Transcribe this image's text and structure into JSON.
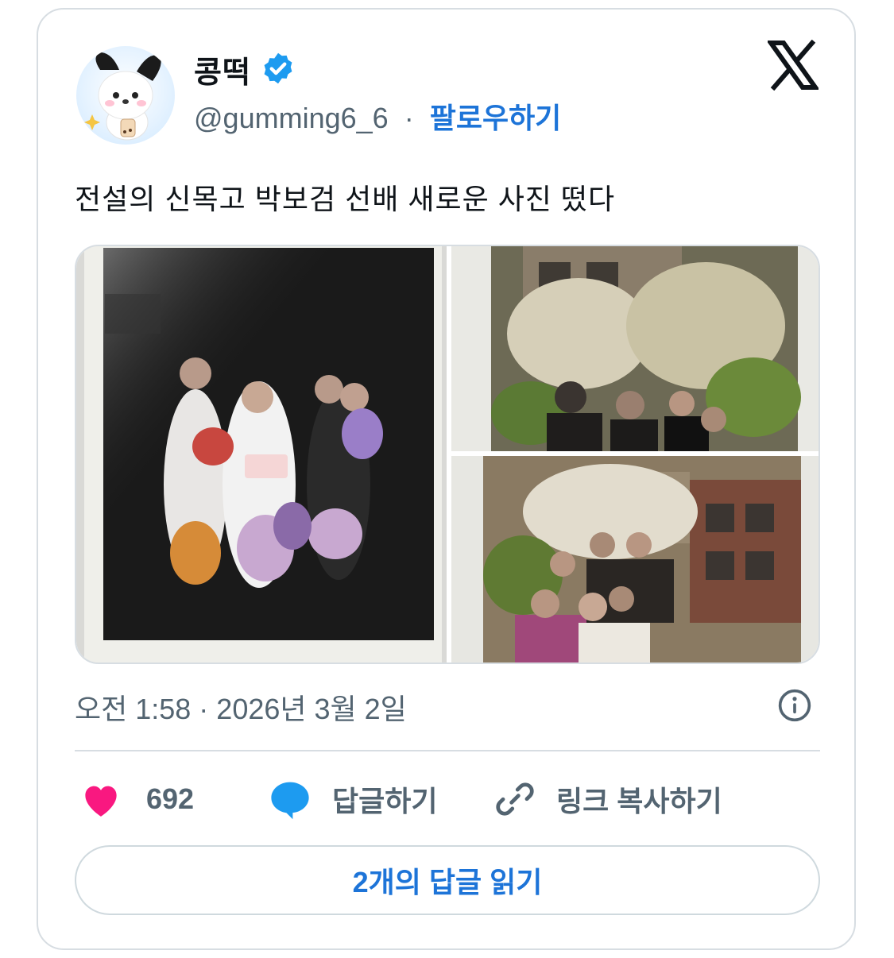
{
  "author": {
    "display_name": "콩떡",
    "handle": "@gumming6_6",
    "separator": "·",
    "follow_label": "팔로우하기",
    "verified_color": "#1d9bf0",
    "avatar_icon": "puppy-character-avatar"
  },
  "brand": {
    "logo_icon": "x-logo-icon"
  },
  "tweet": {
    "text": "전설의 신목고 박보검 선배 새로운 사진 떴다",
    "timestamp": "오전 1:58 · 2026년 3월 2일",
    "media": [
      {
        "icon": "polaroid-photo-birthday-group"
      },
      {
        "icon": "polaroid-photo-spring-trees"
      },
      {
        "icon": "polaroid-photo-school-courtyard"
      }
    ]
  },
  "actions": {
    "like_count": "692",
    "reply_label": "답글하기",
    "copy_link_label": "링크 복사하기",
    "like_color": "#f91880",
    "reply_color": "#1d9bf0"
  },
  "footer": {
    "read_replies_label": "2개의 답글 읽기"
  }
}
